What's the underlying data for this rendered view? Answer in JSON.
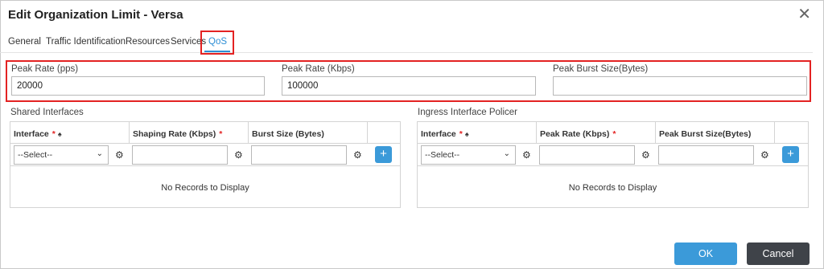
{
  "dialog": {
    "title": "Edit Organization Limit - Versa",
    "close_glyph": "✕"
  },
  "tabs": [
    {
      "label": "General"
    },
    {
      "label": "Traffic Identification"
    },
    {
      "label": "Resources"
    },
    {
      "label": "Services"
    },
    {
      "label": "QoS",
      "active": true
    }
  ],
  "rates": {
    "peak_rate_pps": {
      "label": "Peak Rate (pps)",
      "value": "20000"
    },
    "peak_rate_kbps": {
      "label": "Peak Rate (Kbps)",
      "value": "100000"
    },
    "peak_burst": {
      "label": "Peak Burst Size(Bytes)",
      "value": ""
    }
  },
  "shared_interfaces": {
    "title": "Shared Interfaces",
    "columns": [
      "Interface",
      "Shaping Rate (Kbps)",
      "Burst Size (Bytes)"
    ],
    "select_value": "--Select--",
    "empty_text": "No Records to Display"
  },
  "ingress_policer": {
    "title": "Ingress Interface Policer",
    "columns": [
      "Interface",
      "Peak Rate (Kbps)",
      "Peak Burst Size(Bytes)"
    ],
    "select_value": "--Select--",
    "empty_text": "No Records to Display"
  },
  "required_mark": "*",
  "help_glyph": "♠",
  "icons": {
    "gear": "gear-icon",
    "plus": "plus-icon",
    "chevron": "chevron-down-icon",
    "close": "close-icon"
  },
  "colors": {
    "accent": "#3b9ad9",
    "highlight": "#e32222",
    "dark_button": "#3f4349"
  },
  "footer": {
    "ok_label": "OK",
    "cancel_label": "Cancel"
  }
}
